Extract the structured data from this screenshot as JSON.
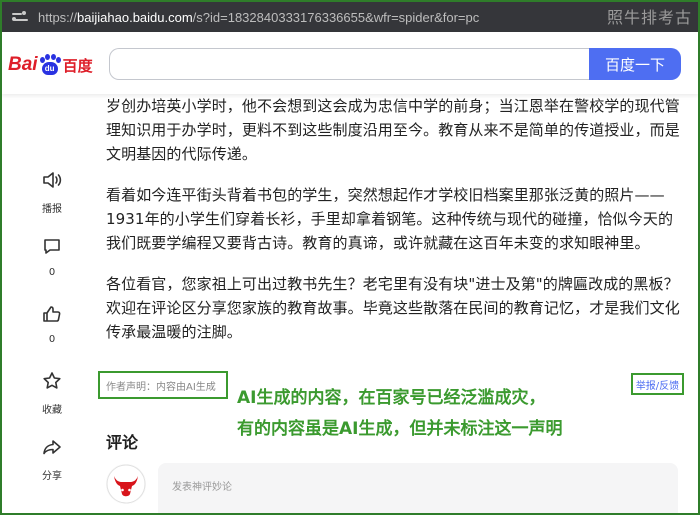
{
  "browser": {
    "url_scheme": "https://",
    "url_host": "baijiahao.baidu.com",
    "url_rest": "/s?id=1832840333176336655&wfr=spider&for=pc"
  },
  "watermark": "照牛排考古",
  "header": {
    "logo_text": "Bai",
    "logo_paw_text": "du",
    "logo_cn": "百度",
    "search_button": "百度一下"
  },
  "article": {
    "paragraphs": [
      "岁创办培英小学时，他不会想到这会成为忠信中学的前身；当江恩举在警校学的现代管理知识用于办学时，更料不到这些制度沿用至今。教育从来不是简单的传道授业，而是文明基因的代际传递。",
      "看着如今连平街头背着书包的学生，突然想起作才学校旧档案里那张泛黄的照片——1931年的小学生们穿着长衫，手里却拿着钢笔。这种传统与现代的碰撞，恰似今天的我们既要学编程又要背古诗。教育的真谛，或许就藏在这百年未变的求知眼神里。",
      "各位看官，您家祖上可出过教书先生？老宅里有没有块\"进士及第\"的牌匾改成的黑板？欢迎在评论区分享您家族的教育故事。毕竟这些散落在民间的教育记忆，才是我们文化传承最温暖的注脚。"
    ]
  },
  "actions": {
    "listen_label": "播报",
    "comment_count": "0",
    "like_count": "0",
    "favorite_label": "收藏",
    "share_label": "分享"
  },
  "declaration": {
    "text": "作者声明：内容由AI生成",
    "report": "举报/反馈"
  },
  "annotation": {
    "line1": "AI生成的内容，在百家号已经泛滥成灾，",
    "line2": "有的内容虽是AI生成，但并未标注这一声明"
  },
  "comments": {
    "title": "评论",
    "placeholder": "发表神评妙论"
  },
  "colors": {
    "accent": "#4e6ef2",
    "baidu_red": "#de1e29",
    "baidu_blue": "#2932e1",
    "annotation_green": "#3b9a2f"
  }
}
